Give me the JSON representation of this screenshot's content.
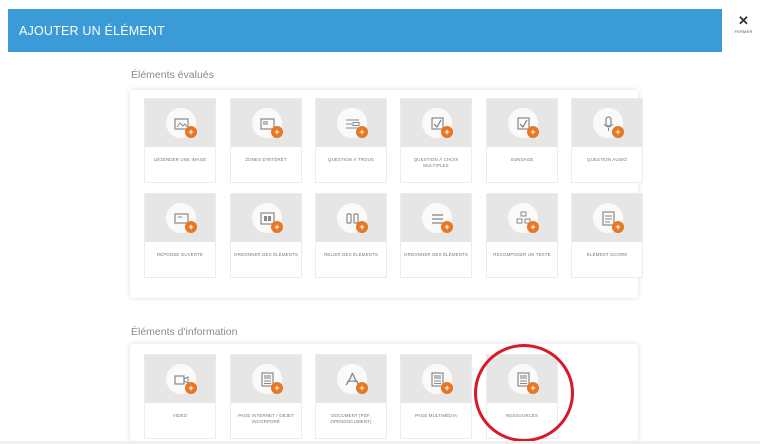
{
  "header": {
    "title": "AJOUTER UN ÉLÉMENT",
    "accent_color": "#3a9bd6"
  },
  "close": {
    "icon": "close-icon",
    "label": "FERMER"
  },
  "sections": [
    {
      "title": "Éléments évalués",
      "items": [
        {
          "label": "LÉGENDER UNE IMAGE",
          "icon": "image-caption-icon"
        },
        {
          "label": "ZONES D'INTÉRÊT",
          "icon": "image-zones-icon"
        },
        {
          "label": "QUESTION À TROUS",
          "icon": "fill-blanks-icon"
        },
        {
          "label": "QUESTION À CHOIX MULTIPLES",
          "icon": "checkbox-icon"
        },
        {
          "label": "SONDAGE",
          "icon": "poll-icon"
        },
        {
          "label": "QUESTION AUDIO",
          "icon": "microphone-icon"
        },
        {
          "label": "RÉPONSE OUVERTE",
          "icon": "open-answer-icon"
        },
        {
          "label": "ORDONNER DES ÉLÉMENTS",
          "icon": "sort-elements-icon"
        },
        {
          "label": "RELIER DES ÉLÉMENTS",
          "icon": "link-elements-icon"
        },
        {
          "label": "ORDONNER DES ÉLÉMENTS",
          "icon": "list-order-icon"
        },
        {
          "label": "RECOMPOSER UN TEXTE",
          "icon": "recompose-text-icon"
        },
        {
          "label": "ÉLÉMENT SCORM",
          "icon": "scorm-icon"
        }
      ]
    },
    {
      "title": "Éléments d'information",
      "items": [
        {
          "label": "VIDÉO",
          "icon": "video-icon"
        },
        {
          "label": "PAGE INTERNET / OBJET INCORPORÉ",
          "icon": "web-page-icon"
        },
        {
          "label": "DOCUMENT (PDF, OPENDOCUMENT)",
          "icon": "pdf-icon"
        },
        {
          "label": "PAGE MULTIMÉDIA",
          "icon": "multimedia-page-icon"
        },
        {
          "label": "RESSOURCES",
          "icon": "resources-icon"
        }
      ]
    }
  ],
  "highlight": {
    "target": "RESSOURCES",
    "color": "#d8192a"
  },
  "add_badge_color": "#e87722"
}
